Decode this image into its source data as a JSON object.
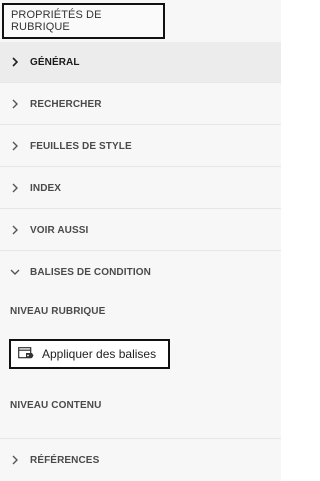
{
  "panel": {
    "title": "PROPRIÉTÉS DE RUBRIQUE"
  },
  "sections": [
    {
      "label": "GÉNÉRAL",
      "expanded": false,
      "active": true
    },
    {
      "label": "RECHERCHER",
      "expanded": false,
      "active": false
    },
    {
      "label": "FEUILLES DE STYLE",
      "expanded": false,
      "active": false
    },
    {
      "label": "INDEX",
      "expanded": false,
      "active": false
    },
    {
      "label": "VOIR AUSSI",
      "expanded": false,
      "active": false
    },
    {
      "label": "BALISES DE CONDITION",
      "expanded": true,
      "active": false
    },
    {
      "label": "RÉFÉRENCES",
      "expanded": false,
      "active": false
    }
  ],
  "conditional_tags": {
    "topic_level_label": "NIVEAU RUBRIQUE",
    "apply_button_label": "Appliquer des balises",
    "apply_button_icon": "apply-tags-icon",
    "content_level_label": "NIVEAU CONTENU"
  },
  "icons": {
    "collapsed": "chevron-right-icon",
    "expanded": "chevron-down-icon"
  }
}
